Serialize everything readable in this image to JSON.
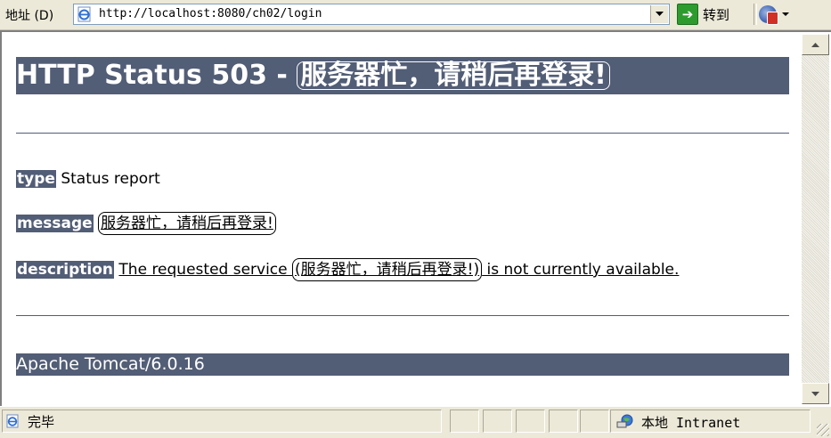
{
  "address_bar": {
    "label": "地址 (D)",
    "url": "http://localhost:8080/ch02/login",
    "go_label": "转到"
  },
  "page": {
    "heading_prefix": "HTTP Status 503 - ",
    "heading_message": "服务器忙，请稍后再登录!",
    "type_label": "type",
    "type_value": "Status report",
    "message_label": "message",
    "message_value": "服务器忙，请稍后再登录!",
    "description_label": "description",
    "description_prefix": "The requested service ",
    "description_service": "(服务器忙，请稍后再登录!)",
    "description_suffix": " is not currently available.",
    "footer": "Apache Tomcat/6.0.16"
  },
  "status_bar": {
    "status_text": "完毕",
    "zone_text": "本地 Intranet"
  },
  "colors": {
    "tomcat_header": "#525d76",
    "chrome": "#ece9d8",
    "go_green": "#2e9b2e"
  },
  "icons": {
    "address_icon": "ie-page-icon",
    "go_icon": "green-arrow-icon",
    "extension_icon": "globe-pdf-icon",
    "status_icon": "ie-page-icon",
    "zone_icon": "intranet-globe-icon"
  }
}
